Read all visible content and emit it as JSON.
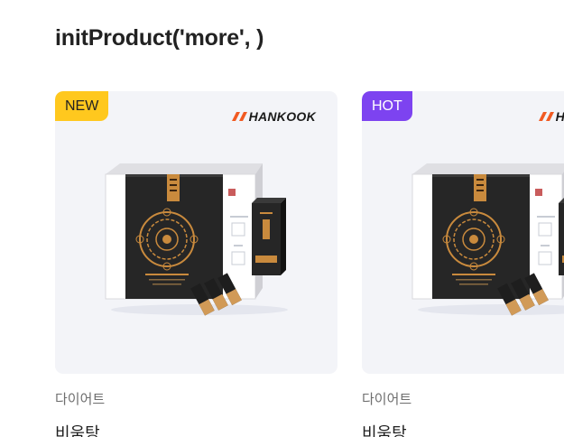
{
  "page": {
    "title": "initProduct('more', )"
  },
  "products": [
    {
      "badge": "NEW",
      "badge_color": "#ffc81e",
      "brand": "HANKOOK",
      "image_icon": "product-box-image",
      "category": "다이어트",
      "name": "비움탕"
    },
    {
      "badge": "HOT",
      "badge_color": "#7d43f0",
      "brand": "HANKOOK",
      "image_icon": "product-box-image",
      "category": "다이어트",
      "name": "비움탕"
    }
  ],
  "colors": {
    "brand_orange": "#f15a22",
    "thumb_bg": "#f3f4f8",
    "box_dark": "#262626",
    "gold": "#c98a3d"
  }
}
